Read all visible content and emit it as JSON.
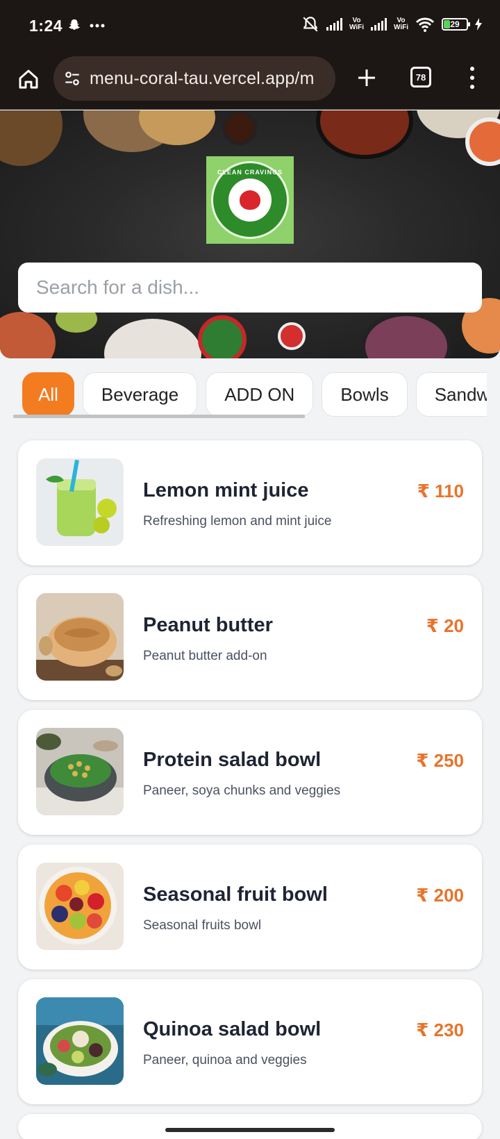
{
  "status": {
    "time": "1:24",
    "battery": "29",
    "vowifi_1": "Vo\nWiFi",
    "vowifi_2": "Vo\nWiFi"
  },
  "browser": {
    "url": "menu-coral-tau.vercel.app/m",
    "tab_count": "78"
  },
  "hero": {
    "logo_text": "CLEAN CRAVINGS",
    "search_placeholder": "Search for a dish..."
  },
  "categories": [
    {
      "label": "All"
    },
    {
      "label": "Beverage"
    },
    {
      "label": "ADD ON"
    },
    {
      "label": "Bowls"
    },
    {
      "label": "Sandwi"
    }
  ],
  "items": [
    {
      "name": "Lemon mint juice",
      "description": "Refreshing lemon and mint juice",
      "price": "₹ 110"
    },
    {
      "name": "Peanut butter",
      "description": "Peanut butter add-on",
      "price": "₹ 20"
    },
    {
      "name": "Protein salad bowl",
      "description": "Paneer, soya chunks and veggies",
      "price": "₹ 250"
    },
    {
      "name": "Seasonal fruit bowl",
      "description": "Seasonal fruits bowl",
      "price": "₹ 200"
    },
    {
      "name": "Quinoa salad bowl",
      "description": "Paneer, quinoa and veggies",
      "price": "₹ 230"
    }
  ],
  "colors": {
    "accent": "#f47c20",
    "price": "#e8732a",
    "chrome": "#1c1614"
  }
}
